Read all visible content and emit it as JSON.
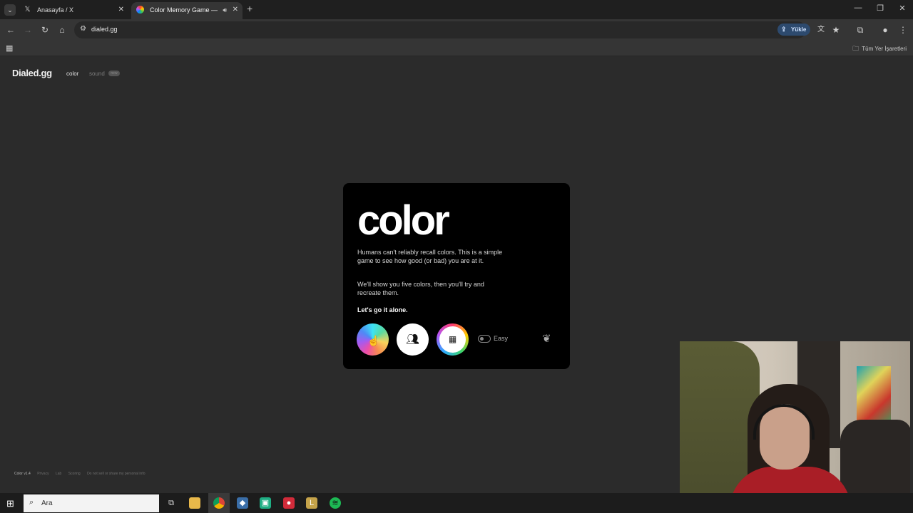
{
  "browser": {
    "tabs": [
      {
        "title": "Anasayfa / X",
        "icon": "x-logo-icon"
      },
      {
        "title": "Color Memory Game — Ho",
        "icon": "color-wheel-icon"
      }
    ],
    "url": "dialed.gg",
    "upload_label": "Yükle",
    "all_bookmarks_label": "Tüm Yer İşaretleri"
  },
  "site": {
    "brand": "Dialed.gg",
    "nav": {
      "color": "color",
      "sound": "sound",
      "badge": "new"
    }
  },
  "card": {
    "title": "color",
    "paragraph1": "Humans can't reliably recall colors. This is a simple game to see how good (or bad) you are at it.",
    "paragraph2": "We'll show you five colors, then you'll try and recreate them.",
    "cta": "Let's go it alone.",
    "difficulty_label": "Easy",
    "difficulty_on": false
  },
  "footer": {
    "version": "Color v1.4",
    "links": [
      "Privacy",
      "Lab",
      "Scoring",
      "Do not sell or share my personal info"
    ]
  },
  "taskbar": {
    "search_placeholder": "Ara",
    "apps": [
      "task-view-icon",
      "file-explorer-icon",
      "chrome-icon",
      "app-icon",
      "app-icon",
      "app-icon",
      "app-icon",
      "spotify-icon"
    ]
  }
}
